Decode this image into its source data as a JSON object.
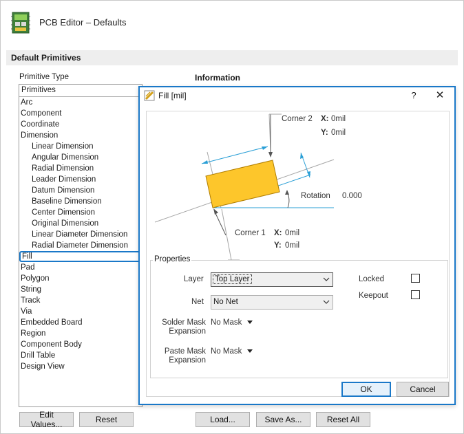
{
  "window": {
    "title": "PCB Editor – Defaults"
  },
  "section": {
    "title": "Default Primitives"
  },
  "primitive_panel": {
    "label": "Primitive Type",
    "header": "Primitives",
    "items": [
      {
        "label": "Arc",
        "child": false
      },
      {
        "label": "Component",
        "child": false
      },
      {
        "label": "Coordinate",
        "child": false
      },
      {
        "label": "Dimension",
        "child": false
      },
      {
        "label": "Linear Dimension",
        "child": true
      },
      {
        "label": "Angular Dimension",
        "child": true
      },
      {
        "label": "Radial Dimension",
        "child": true
      },
      {
        "label": "Leader Dimension",
        "child": true
      },
      {
        "label": "Datum Dimension",
        "child": true
      },
      {
        "label": "Baseline Dimension",
        "child": true
      },
      {
        "label": "Center Dimension",
        "child": true
      },
      {
        "label": "Original Dimension",
        "child": true
      },
      {
        "label": "Linear Diameter Dimension",
        "child": true
      },
      {
        "label": "Radial Diameter Dimension",
        "child": true
      },
      {
        "label": "Fill",
        "child": false,
        "selected": true
      },
      {
        "label": "Pad",
        "child": false
      },
      {
        "label": "Polygon",
        "child": false
      },
      {
        "label": "String",
        "child": false
      },
      {
        "label": "Track",
        "child": false
      },
      {
        "label": "Via",
        "child": false
      },
      {
        "label": "Embedded Board",
        "child": false
      },
      {
        "label": "Region",
        "child": false
      },
      {
        "label": "Component Body",
        "child": false
      },
      {
        "label": "Drill Table",
        "child": false
      },
      {
        "label": "Design View",
        "child": false
      }
    ]
  },
  "information": {
    "label": "Information"
  },
  "buttons": {
    "edit_values": "Edit Values...",
    "reset": "Reset",
    "load": "Load...",
    "save_as": "Save As...",
    "reset_all": "Reset All"
  },
  "dialog": {
    "title": "Fill [mil]",
    "help": "?",
    "close": "✕",
    "corner2": {
      "label": "Corner 2",
      "x_label": "X:",
      "x_value": "0mil",
      "y_label": "Y:",
      "y_value": "0mil"
    },
    "corner1": {
      "label": "Corner 1",
      "x_label": "X:",
      "x_value": "0mil",
      "y_label": "Y:",
      "y_value": "0mil"
    },
    "rotation": {
      "label": "Rotation",
      "value": "0.000"
    },
    "properties": {
      "title": "Properties",
      "layer_label": "Layer",
      "layer_value": "Top Layer",
      "net_label": "Net",
      "net_value": "No Net",
      "locked_label": "Locked",
      "locked": false,
      "keepout_label": "Keepout",
      "keepout": false,
      "solder_mask_label_1": "Solder Mask",
      "solder_mask_label_2": "Expansion",
      "solder_mask_value": "No Mask",
      "paste_mask_label_1": "Paste Mask",
      "paste_mask_label_2": "Expansion",
      "paste_mask_value": "No Mask"
    },
    "ok": "OK",
    "cancel": "Cancel"
  },
  "colors": {
    "accent": "#1a78c8",
    "fill_shape": "#fdc62b",
    "link_blue": "#1a66c0",
    "dimension_cyan": "#2a9fd6"
  }
}
